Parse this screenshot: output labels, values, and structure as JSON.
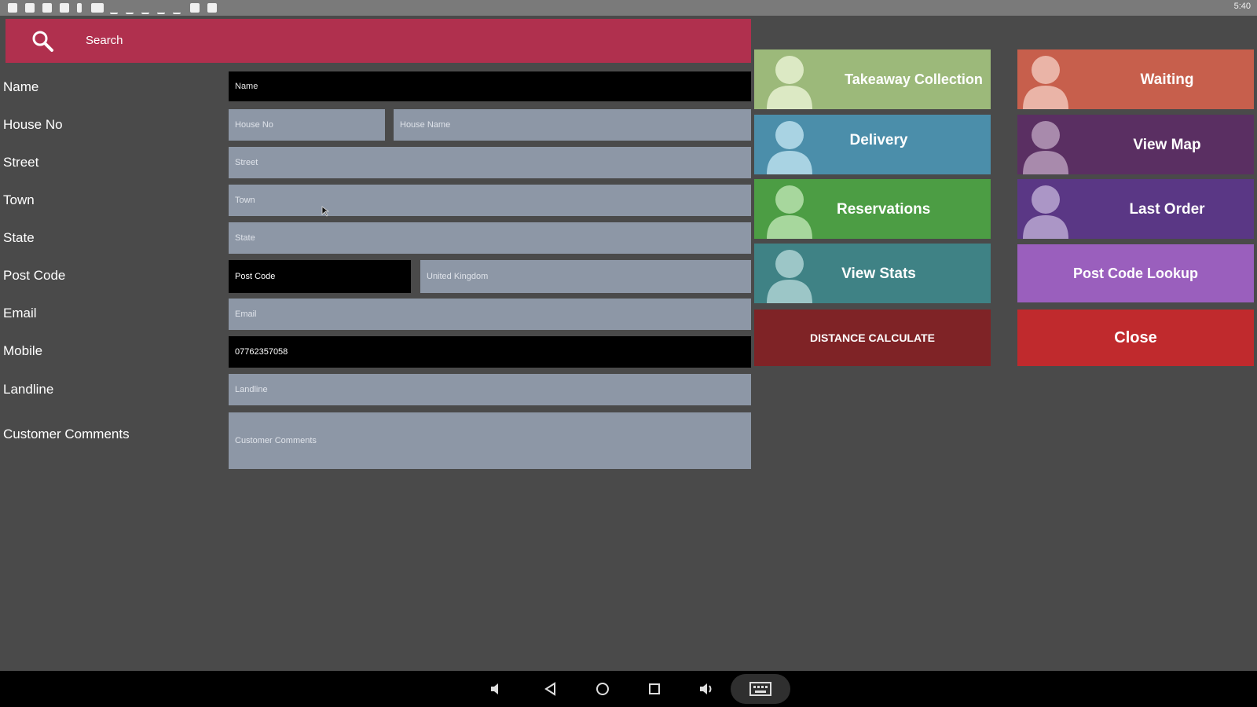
{
  "search": {
    "label": "Search"
  },
  "form": {
    "name": {
      "label": "Name",
      "placeholder": "Name"
    },
    "house_no": {
      "label": "House No",
      "placeholder": "House No"
    },
    "house_name": {
      "placeholder": "House Name"
    },
    "street": {
      "label": "Street",
      "placeholder": "Street"
    },
    "town": {
      "label": "Town",
      "placeholder": "Town"
    },
    "state": {
      "label": "State",
      "placeholder": "State"
    },
    "post_code": {
      "label": "Post Code",
      "placeholder": "Post Code"
    },
    "country": {
      "value": "United Kingdom"
    },
    "email": {
      "label": "Email",
      "placeholder": "Email"
    },
    "mobile": {
      "label": "Mobile",
      "value": "07762357058"
    },
    "landline": {
      "label": "Landline",
      "placeholder": "Landline"
    },
    "comments": {
      "label": "Customer Comments",
      "placeholder": "Customer Comments"
    }
  },
  "buttons": {
    "takeaway": "Takeaway Collection",
    "waiting": "Waiting",
    "delivery": "Delivery",
    "view_map": "View Map",
    "reservations": "Reservations",
    "last_order": "Last Order",
    "view_stats": "View Stats",
    "post_code_lookup": "Post Code Lookup",
    "distance": "DISTANCE CALCULATE",
    "close": "Close"
  },
  "colors": {
    "search_bar": "#b0304e",
    "takeaway": "#9cb97a",
    "waiting": "#c75f4c",
    "delivery": "#4b8eaa",
    "view_map": "#5a2f62",
    "reservations": "#4c9d44",
    "last_order": "#5a3785",
    "view_stats": "#3f8285",
    "post_code_lookup": "#9a5fbd",
    "distance": "#7f2326",
    "close": "#c02a2d"
  },
  "icons": {
    "search": "search-icon",
    "avatar": "person-icon",
    "nav": [
      "volume-down-icon",
      "back-icon",
      "home-icon",
      "recents-icon",
      "volume-up-icon",
      "keyboard-icon"
    ]
  },
  "status_bar": {
    "time": "5:40"
  }
}
